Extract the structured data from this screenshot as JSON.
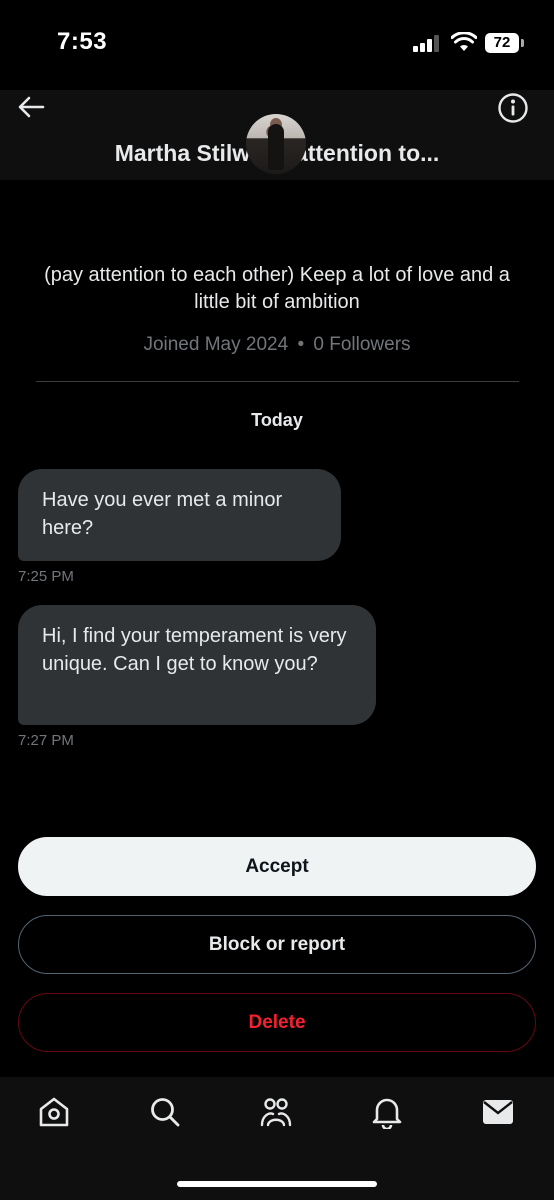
{
  "status_bar": {
    "time": "7:53",
    "battery": "72"
  },
  "header": {
    "title": "Martha Stilwell (pay attention to...",
    "title_visible": "Martha Stilwel          y attention to..."
  },
  "profile": {
    "bio": "(pay attention to each other) Keep a lot of love and a little bit of ambition",
    "joined": "Joined May 2024",
    "separator": "•",
    "followers": "0 Followers"
  },
  "conversation": {
    "date_label": "Today",
    "messages": [
      {
        "text": "Have you ever met a minor here?",
        "time": "7:25 PM"
      },
      {
        "text": "Hi, I find your temperament is very unique. Can I get to know you?",
        "time": "7:27 PM"
      }
    ]
  },
  "actions": {
    "accept_label": "Accept",
    "block_label": "Block or report",
    "delete_label": "Delete"
  },
  "nav": {
    "icons": [
      "home-icon",
      "search-icon",
      "communities-icon",
      "notifications-icon",
      "messages-icon"
    ]
  },
  "colors": {
    "background": "#000000",
    "bubble": "#2f3336",
    "muted": "#71767b",
    "delete": "#f4212e"
  }
}
